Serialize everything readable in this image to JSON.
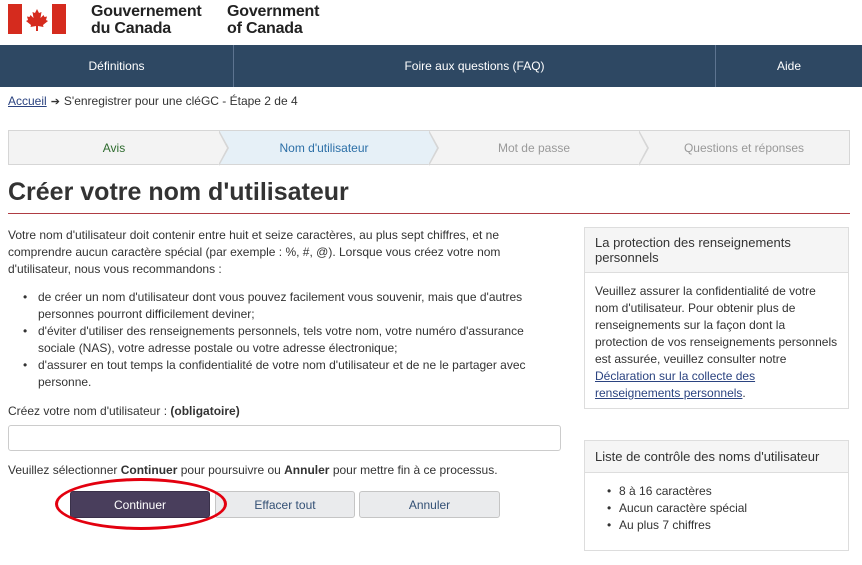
{
  "header": {
    "gov_fr_line1": "Gouvernement",
    "gov_fr_line2": "du Canada",
    "gov_en_line1": "Government",
    "gov_en_line2": "of Canada",
    "flag_icon": "canada-flag-icon",
    "colors": {
      "flag_red": "#d52b1e",
      "nav_bg": "#2e4863"
    }
  },
  "nav": {
    "items": [
      {
        "label": "Définitions"
      },
      {
        "label": "Foire aux questions (FAQ)"
      },
      {
        "label": "Aide"
      }
    ]
  },
  "breadcrumb": {
    "home": "Accueil",
    "arrow": "➔",
    "current": "S'enregistrer pour une cléGC - Étape 2 de 4"
  },
  "steps": [
    {
      "label": "Avis",
      "state": "done"
    },
    {
      "label": "Nom d'utilisateur",
      "state": "active"
    },
    {
      "label": "Mot de passe",
      "state": "todo"
    },
    {
      "label": "Questions et réponses",
      "state": "todo"
    }
  ],
  "main": {
    "title": "Créer votre nom d'utilisateur",
    "intro": "Votre nom d'utilisateur doit contenir entre huit et seize caractères, au plus sept chiffres, et ne comprendre aucun caractère spécial (par exemple : %, #, @). Lorsque vous créez votre nom d'utilisateur, nous vous recommandons :",
    "bullets": [
      "de créer un nom d'utilisateur dont vous pouvez facilement vous souvenir, mais que d'autres personnes pourront difficilement deviner;",
      "d'éviter d'utiliser des renseignements personnels, tels votre nom, votre numéro d'assurance sociale (NAS), votre adresse postale ou votre adresse électronique;",
      "d'assurer en tout temps la confidentialité de votre nom d'utilisateur et de ne le partager avec personne."
    ],
    "field_label": "Créez votre nom d'utilisateur :",
    "field_required": "(obligatoire)",
    "field_value": "",
    "instruction_pre": "Veuillez sélectionner ",
    "instruction_continue": "Continuer",
    "instruction_mid": " pour poursuivre ou ",
    "instruction_cancel": "Annuler",
    "instruction_post": " pour mettre fin à ce processus."
  },
  "buttons": {
    "continue": "Continuer",
    "clear": "Effacer tout",
    "cancel": "Annuler",
    "highlight_color": "#e3000f"
  },
  "privacy_panel": {
    "title": "La protection des renseignements personnels",
    "body": "Veuillez assurer la confidentialité de votre nom d'utilisateur. Pour obtenir plus de renseignements sur la façon dont la protection de vos renseignements personnels est assurée, veuillez consulter notre ",
    "link": "Déclaration sur la collecte des renseignements personnels",
    "body_end": "."
  },
  "checklist_panel": {
    "title": "Liste de contrôle des noms d'utilisateur",
    "items": [
      "8 à 16 caractères",
      "Aucun caractère spécial",
      "Au plus 7 chiffres"
    ]
  }
}
